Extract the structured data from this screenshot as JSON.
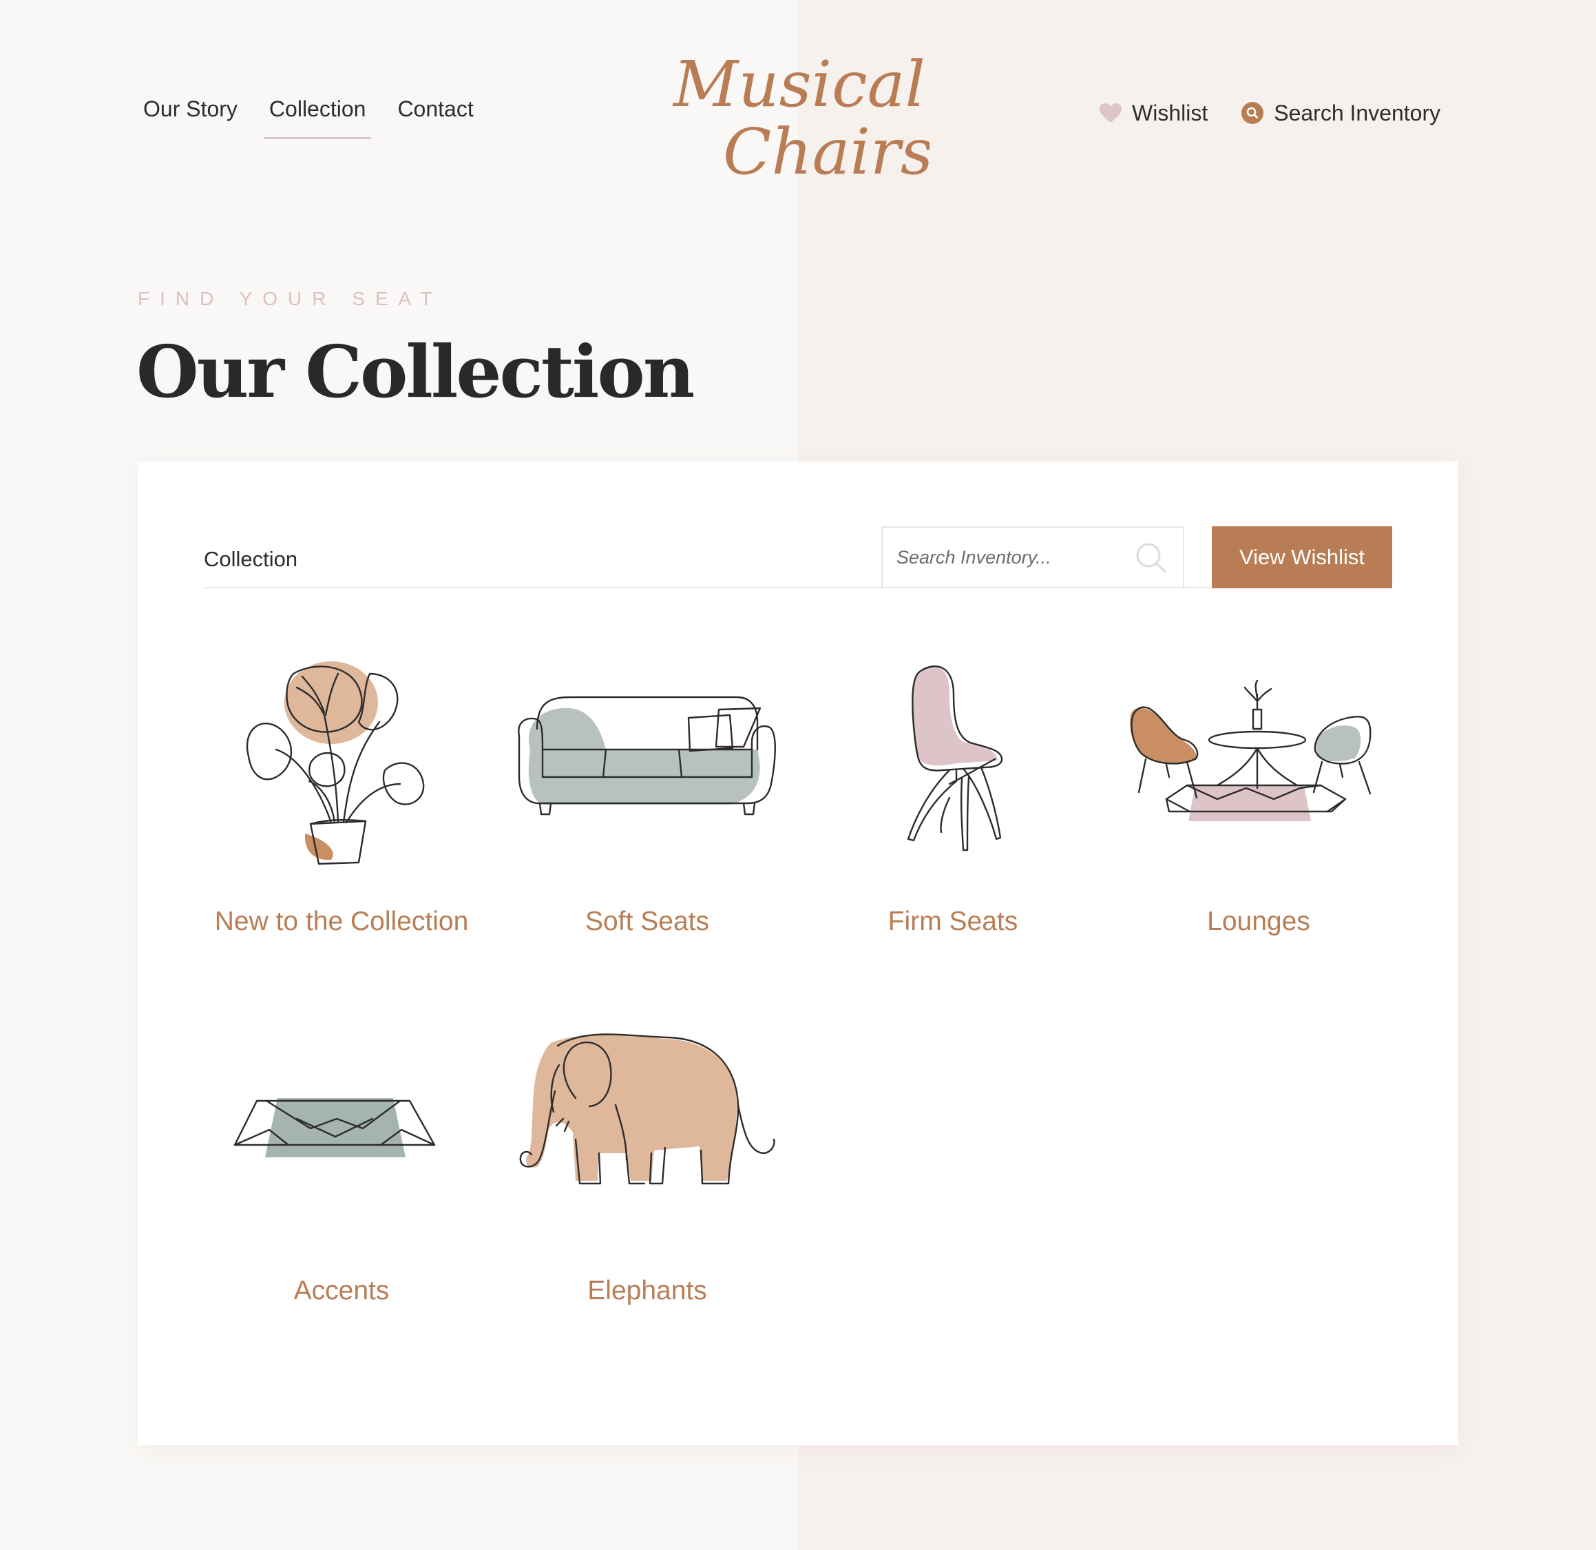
{
  "nav": {
    "items": [
      {
        "label": "Our Story"
      },
      {
        "label": "Collection"
      },
      {
        "label": "Contact"
      }
    ],
    "wishlist_label": "Wishlist",
    "search_label": "Search Inventory"
  },
  "brand": {
    "logo_line1": "Musical",
    "logo_line2": "Chairs"
  },
  "hero": {
    "eyebrow": "FIND YOUR SEAT",
    "title": "Our Collection"
  },
  "toolbar": {
    "label": "Collection",
    "search_placeholder": "Search Inventory...",
    "wishlist_button": "View Wishlist"
  },
  "categories": [
    {
      "label": "New to the Collection",
      "icon": "plant-icon"
    },
    {
      "label": "Soft Seats",
      "icon": "sofa-icon"
    },
    {
      "label": "Firm Seats",
      "icon": "chair-icon"
    },
    {
      "label": "Lounges",
      "icon": "lounge-icon"
    },
    {
      "label": "Accents",
      "icon": "rug-icon"
    },
    {
      "label": "Elephants",
      "icon": "elephant-icon"
    }
  ],
  "colors": {
    "accent": "#b87d55",
    "blush": "#dcc4c8",
    "sage": "#b7c2c0",
    "peach": "#dfb79a",
    "page_bg": "#faf8f6"
  }
}
